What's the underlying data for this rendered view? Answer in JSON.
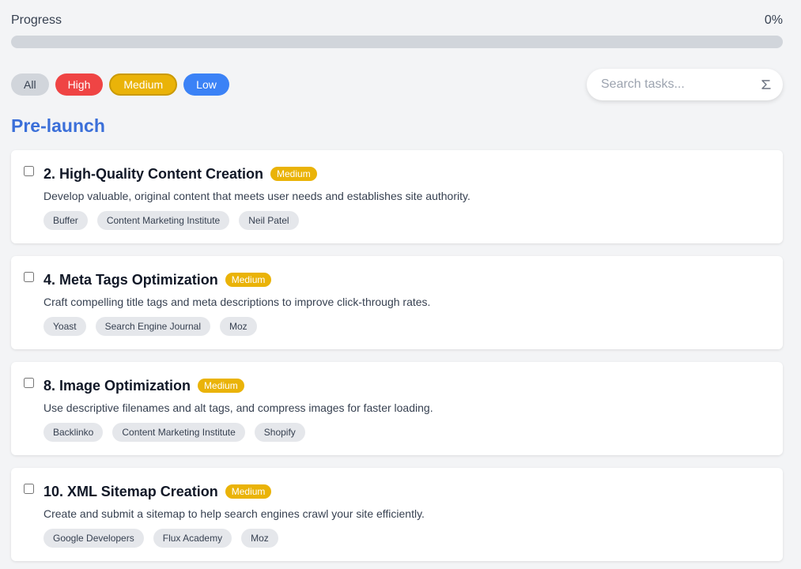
{
  "progress": {
    "label": "Progress",
    "percent_text": "0%",
    "value": 0
  },
  "filters": [
    {
      "label": "All",
      "color": "#d1d5db"
    },
    {
      "label": "High",
      "color": "#ef4444"
    },
    {
      "label": "Medium",
      "color": "#eab308"
    },
    {
      "label": "Low",
      "color": "#3b82f6"
    }
  ],
  "search": {
    "placeholder": "Search tasks...",
    "icon": "sort-icon"
  },
  "section": {
    "title": "Pre-launch"
  },
  "tasks": [
    {
      "title": "2. High-Quality Content Creation",
      "priority": "Medium",
      "description": "Develop valuable, original content that meets user needs and establishes site authority.",
      "tags": [
        "Buffer",
        "Content Marketing Institute",
        "Neil Patel"
      ]
    },
    {
      "title": "4. Meta Tags Optimization",
      "priority": "Medium",
      "description": "Craft compelling title tags and meta descriptions to improve click-through rates.",
      "tags": [
        "Yoast",
        "Search Engine Journal",
        "Moz"
      ]
    },
    {
      "title": "8. Image Optimization",
      "priority": "Medium",
      "description": "Use descriptive filenames and alt tags, and compress images for faster loading.",
      "tags": [
        "Backlinko",
        "Content Marketing Institute",
        "Shopify"
      ]
    },
    {
      "title": "10. XML Sitemap Creation",
      "priority": "Medium",
      "description": "Create and submit a sitemap to help search engines crawl your site efficiently.",
      "tags": [
        "Google Developers",
        "Flux Academy",
        "Moz"
      ]
    }
  ],
  "colors": {
    "accent": "#3b6fd9",
    "medium_badge": "#eab308",
    "high": "#ef4444",
    "low": "#3b82f6"
  }
}
